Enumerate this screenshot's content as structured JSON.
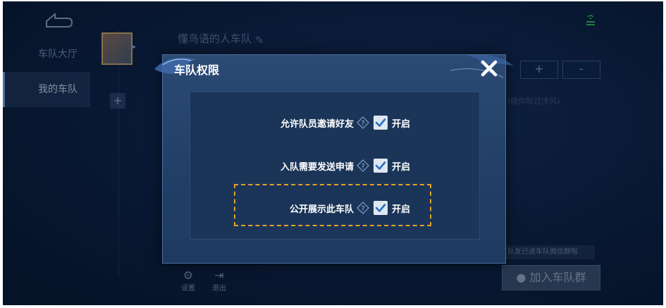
{
  "background": {
    "nav": [
      {
        "label": "车队大厅",
        "active": false
      },
      {
        "label": "我的车队",
        "active": true
      }
    ],
    "team_name": "懂鸟语的人车队",
    "add_label": "+",
    "plus_label": "+",
    "minus_label": "-",
    "note_text": "(陪你吹过冷风)",
    "wechat_note": "队友已进车队微信群啦",
    "join_label": "加入车队群",
    "bottom": {
      "settings_label": "设置",
      "exit_label": "退出"
    }
  },
  "dialog": {
    "title": "车队权限",
    "close_icon": "close-icon",
    "options": [
      {
        "label": "允许队员邀请好友",
        "checked": true,
        "status": "开启"
      },
      {
        "label": "入队需要发送申请",
        "checked": true,
        "status": "开启"
      },
      {
        "label": "公开展示此车队",
        "checked": true,
        "status": "开启",
        "highlighted": true
      }
    ]
  },
  "colors": {
    "accent": "#3b73b8",
    "highlight": "#e3a02a",
    "dialog_bg": "#2b4a74"
  }
}
